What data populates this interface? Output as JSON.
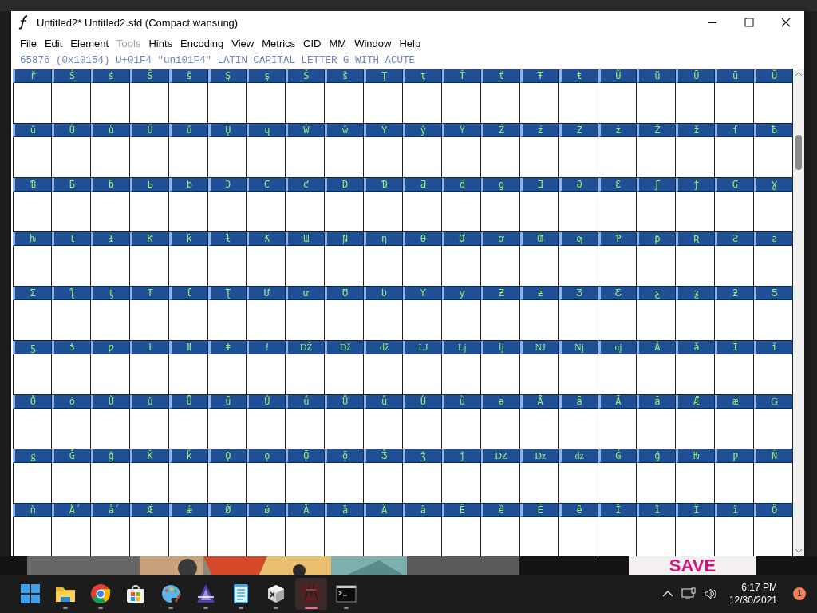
{
  "window": {
    "title": "Untitled2*  Untitled2.sfd (Compact wansung)"
  },
  "menu": [
    {
      "label": "File",
      "disabled": false
    },
    {
      "label": "Edit",
      "disabled": false
    },
    {
      "label": "Element",
      "disabled": false
    },
    {
      "label": "Tools",
      "disabled": true
    },
    {
      "label": "Hints",
      "disabled": false
    },
    {
      "label": "Encoding",
      "disabled": false
    },
    {
      "label": "View",
      "disabled": false
    },
    {
      "label": "Metrics",
      "disabled": false
    },
    {
      "label": "CID",
      "disabled": false
    },
    {
      "label": "MM",
      "disabled": false
    },
    {
      "label": "Window",
      "disabled": false
    },
    {
      "label": "Help",
      "disabled": false
    }
  ],
  "info_line": "65876 (0x10154) U+01F4 \"uni01F4\" LATIN CAPITAL LETTER G WITH ACUTE",
  "glyph_rows": [
    [
      "ř",
      "Ś",
      "ś",
      "Ŝ",
      "ŝ",
      "Ş",
      "ş",
      "Š",
      "š",
      "Ţ",
      "ţ",
      "Ť",
      "ť",
      "Ŧ",
      "ŧ",
      "Ũ",
      "ũ",
      "Ū",
      "ū",
      "Ŭ"
    ],
    [
      "ŭ",
      "Ů",
      "ů",
      "Ű",
      "ű",
      "Ų",
      "ų",
      "Ŵ",
      "ŵ",
      "Ŷ",
      "ŷ",
      "Ÿ",
      "Ź",
      "ź",
      "Ż",
      "ż",
      "Ž",
      "ž",
      "ſ",
      "ƀ"
    ],
    [
      "Ɓ",
      "Ƃ",
      "ƃ",
      "Ƅ",
      "ƅ",
      "Ɔ",
      "Ƈ",
      "ƈ",
      "Ɖ",
      "Ɗ",
      "Ƌ",
      "ƌ",
      "ƍ",
      "Ǝ",
      "Ə",
      "Ɛ",
      "Ƒ",
      "ƒ",
      "Ɠ",
      "Ɣ"
    ],
    [
      "ƕ",
      "Ɩ",
      "Ɨ",
      "Ƙ",
      "ƙ",
      "ƚ",
      "ƛ",
      "Ɯ",
      "Ɲ",
      "ƞ",
      "Ɵ",
      "Ơ",
      "ơ",
      "Ƣ",
      "ƣ",
      "Ƥ",
      "ƥ",
      "Ʀ",
      "Ƨ",
      "ƨ"
    ],
    [
      "Ʃ",
      "ƪ",
      "ƫ",
      "Ƭ",
      "ƭ",
      "Ʈ",
      "Ư",
      "ư",
      "Ʊ",
      "Ʋ",
      "Ƴ",
      "ƴ",
      "Ƶ",
      "ƶ",
      "Ʒ",
      "Ƹ",
      "ƹ",
      "ƺ",
      "ƻ",
      "Ƽ"
    ],
    [
      "ƽ",
      "ƾ",
      "ƿ",
      "ǀ",
      "ǁ",
      "ǂ",
      "ǃ",
      "Ǆ",
      "ǅ",
      "ǆ",
      "Ǉ",
      "ǈ",
      "ǉ",
      "Ǌ",
      "ǋ",
      "ǌ",
      "Ǎ",
      "ǎ",
      "Ǐ",
      "ǐ"
    ],
    [
      "Ǒ",
      "ǒ",
      "Ǔ",
      "ǔ",
      "Ǖ",
      "ǖ",
      "Ǘ",
      "ǘ",
      "Ǚ",
      "ǚ",
      "Ǜ",
      "ǜ",
      "ǝ",
      "Ǟ",
      "ǟ",
      "Ǡ",
      "ǡ",
      "Ǣ",
      "ǣ",
      "Ǥ"
    ],
    [
      "ǥ",
      "Ǧ",
      "ǧ",
      "Ǩ",
      "ǩ",
      "Ǫ",
      "ǫ",
      "Ǭ",
      "ǭ",
      "Ǯ",
      "ǯ",
      "ǰ",
      "Ǳ",
      "ǲ",
      "ǳ",
      "Ǵ",
      "ǵ",
      "Ƕ",
      "Ƿ",
      "Ǹ"
    ],
    [
      "ǹ",
      "Ǻ",
      "ǻ",
      "Ǽ",
      "ǽ",
      "Ǿ",
      "ǿ",
      "Ȁ",
      "ȁ",
      "Ȃ",
      "ȃ",
      "Ȅ",
      "ȅ",
      "Ȇ",
      "ȇ",
      "Ȉ",
      "ȉ",
      "Ȋ",
      "ȋ",
      "Ȍ"
    ]
  ],
  "background": {
    "save_text": "SAVE"
  },
  "taskbar": {
    "apps": [
      {
        "selected": false,
        "running": false
      },
      {
        "selected": false,
        "running": true
      },
      {
        "selected": false,
        "running": true
      },
      {
        "selected": false,
        "running": false
      },
      {
        "selected": false,
        "running": true
      },
      {
        "selected": false,
        "running": true
      },
      {
        "selected": false,
        "running": true
      },
      {
        "selected": false,
        "running": true
      },
      {
        "selected": true,
        "running": true
      },
      {
        "selected": false,
        "running": true
      }
    ],
    "time": "6:17 PM",
    "date": "12/30/2021",
    "notifications": "1"
  }
}
